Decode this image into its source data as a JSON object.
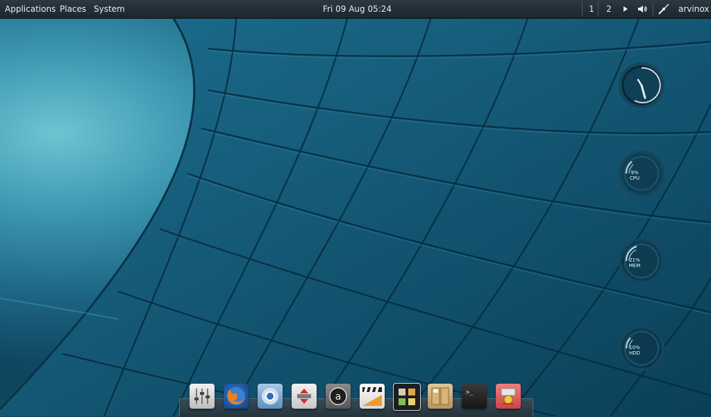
{
  "top_panel": {
    "menus": {
      "applications": "Applications",
      "places": "Places",
      "system": "System"
    },
    "clock": "Fri 09 Aug 05:24",
    "workspaces": [
      "1",
      "2"
    ],
    "user": "arvinox",
    "tray_icons": [
      "play-arrow-icon",
      "volume-icon",
      "network-icon"
    ]
  },
  "desktop_gauges": [
    {
      "kind": "clock",
      "icon": "analog-clock-icon"
    },
    {
      "percent": "9%",
      "name": "CPU",
      "value": 9
    },
    {
      "percent": "21%",
      "name": "MEM",
      "value": 21
    },
    {
      "percent": "10%",
      "name": "HDD",
      "value": 10
    }
  ],
  "dock": {
    "items": [
      "mixer-icon",
      "firefox-icon",
      "chromium-icon",
      "sync-tool-icon",
      "amarok-icon",
      "video-editor-icon",
      "file-manager-icon",
      "archive-manager-icon",
      "terminal-icon",
      "utility-icon"
    ]
  },
  "colors": {
    "panel": "#23303a",
    "wallpaper_dark": "#0b3d55",
    "wallpaper_light": "#4fb3c8",
    "gauge_arc": "#cfdce3"
  }
}
